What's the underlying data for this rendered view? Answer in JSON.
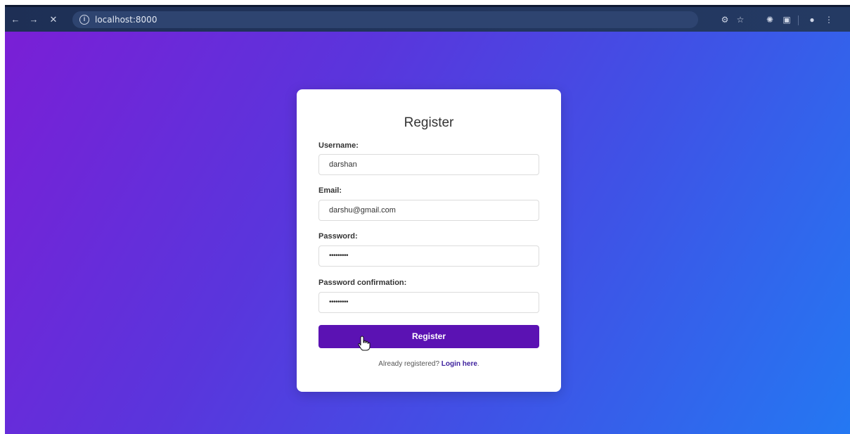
{
  "browser": {
    "url": "localhost:8000",
    "nav": {
      "back_icon": "back-arrow-icon",
      "forward_icon": "forward-arrow-icon",
      "stop_icon": "close-icon"
    }
  },
  "form": {
    "title": "Register",
    "fields": [
      {
        "label": "Username:",
        "value": "darshan"
      },
      {
        "label": "Email:",
        "value": "darshu@gmail.com"
      },
      {
        "label": "Password:",
        "value": "•••••••••"
      },
      {
        "label": "Password confirmation:",
        "value": "•••••••••"
      }
    ],
    "submit_label": "Register",
    "login_prompt": "Already registered?",
    "login_link": "Login here"
  },
  "colors": {
    "accent": "#5b12b3",
    "gradient_start": "#7a1fd6",
    "gradient_end": "#2478f2"
  }
}
